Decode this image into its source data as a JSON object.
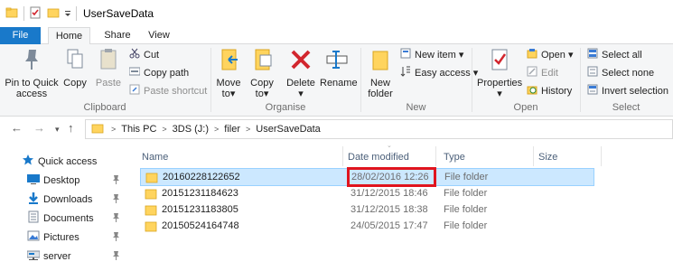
{
  "window": {
    "title": "UserSaveData"
  },
  "tabs": {
    "file": "File",
    "home": "Home",
    "share": "Share",
    "view": "View"
  },
  "ribbon": {
    "clipboard": {
      "label": "Clipboard",
      "pin_line1": "Pin to Quick",
      "pin_line2": "access",
      "copy": "Copy",
      "paste": "Paste",
      "cut": "Cut",
      "copy_path": "Copy path",
      "paste_shortcut": "Paste shortcut"
    },
    "organise": {
      "label": "Organise",
      "move_line1": "Move",
      "move_line2": "to",
      "copy_line1": "Copy",
      "copy_line2": "to",
      "delete": "Delete",
      "rename": "Rename"
    },
    "new": {
      "label": "New",
      "new_folder_line1": "New",
      "new_folder_line2": "folder",
      "new_item": "New item",
      "easy_access": "Easy access"
    },
    "open": {
      "label": "Open",
      "properties": "Properties",
      "open": "Open",
      "edit": "Edit",
      "history": "History"
    },
    "select": {
      "label": "Select",
      "select_all": "Select all",
      "select_none": "Select none",
      "invert": "Invert selection"
    }
  },
  "address": {
    "crumbs": [
      "This PC",
      "3DS (J:)",
      "filer",
      "UserSaveData"
    ]
  },
  "nav_pane": {
    "items": [
      {
        "label": "Quick access",
        "icon": "star-icon"
      },
      {
        "label": "Desktop",
        "icon": "desktop-icon"
      },
      {
        "label": "Downloads",
        "icon": "download-icon"
      },
      {
        "label": "Documents",
        "icon": "documents-icon"
      },
      {
        "label": "Pictures",
        "icon": "pictures-icon"
      },
      {
        "label": "server",
        "icon": "network-drive-icon"
      }
    ]
  },
  "columns": {
    "name": "Name",
    "date": "Date modified",
    "type": "Type",
    "size": "Size"
  },
  "files": [
    {
      "name": "20160228122652",
      "date": "28/02/2016 12:26",
      "type": "File folder",
      "selected": true
    },
    {
      "name": "20151231184623",
      "date": "31/12/2015 18:46",
      "type": "File folder"
    },
    {
      "name": "20151231183805",
      "date": "31/12/2015 18:38",
      "type": "File folder"
    },
    {
      "name": "20150524164748",
      "date": "24/05/2015 17:47",
      "type": "File folder"
    }
  ],
  "colors": {
    "accent": "#1979ca",
    "selection": "#cce8ff",
    "highlight_box": "#e0141e",
    "folder": "#ffd45e"
  }
}
